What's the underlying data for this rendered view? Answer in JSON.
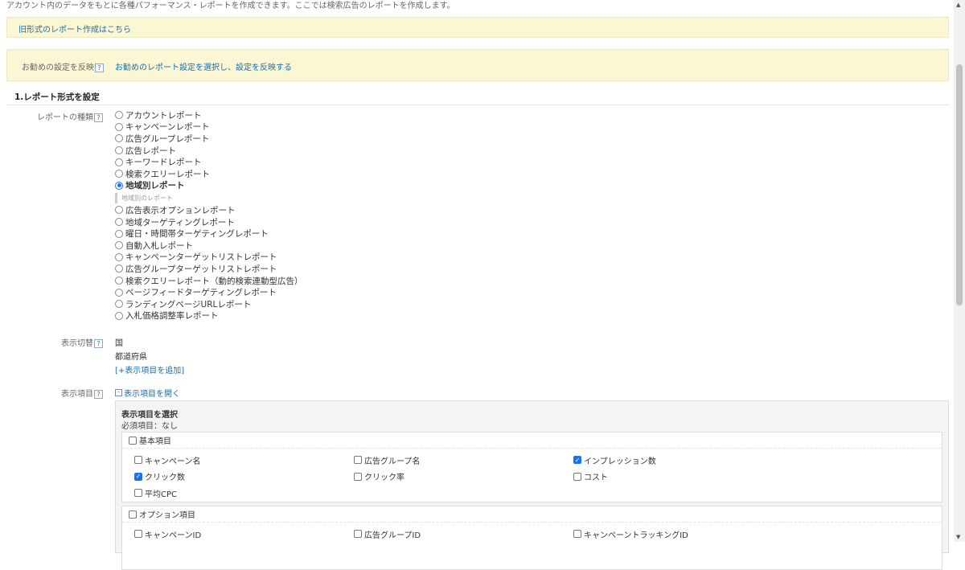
{
  "intro": "アカウント内のデータをもとに各種パフォーマンス・レポートを作成できます。ここでは検索広告のレポートを作成します。",
  "legacy_link": "旧形式のレポート作成はこちら",
  "recommend": {
    "label": "お勧めの設定を反映",
    "link": "お勧めのレポート設定を選択し、設定を反映する"
  },
  "help": "?",
  "section1": "1.レポート形式を設定",
  "report_type": {
    "label": "レポートの種類",
    "options_top": [
      "アカウントレポート",
      "キャンペーンレポート",
      "広告グループレポート",
      "広告レポート",
      "キーワードレポート",
      "検索クエリーレポート"
    ],
    "selected": "地域別レポート",
    "sub_note": "地域別のレポート",
    "options_bottom": [
      "広告表示オプションレポート",
      "地域ターゲティングレポート",
      "曜日・時間帯ターゲティングレポート",
      "自動入札レポート",
      "キャンペーンターゲットリストレポート",
      "広告グループターゲットリストレポート",
      "検索クエリーレポート（動的検索連動型広告）",
      "ページフィードターゲティングレポート",
      "ランディングページURLレポート",
      "入札価格調整率レポート"
    ]
  },
  "display_switch": {
    "label": "表示切替",
    "items": [
      "国",
      "都道府県"
    ],
    "add_link": "[+表示項目を追加]"
  },
  "display_items": {
    "label": "表示項目",
    "toggle": "表示項目を開く",
    "panel_title": "表示項目を選択",
    "required": "必須項目：なし",
    "groups": [
      {
        "name": "基本項目",
        "items": [
          {
            "label": "キャンペーン名",
            "checked": false
          },
          {
            "label": "広告グループ名",
            "checked": false
          },
          {
            "label": "インプレッション数",
            "checked": true
          },
          {
            "label": "クリック数",
            "checked": true
          },
          {
            "label": "クリック率",
            "checked": false
          },
          {
            "label": "コスト",
            "checked": false
          },
          {
            "label": "平均CPC",
            "checked": false
          }
        ]
      },
      {
        "name": "オプション項目",
        "items": [
          {
            "label": "キャンペーンID",
            "checked": false
          },
          {
            "label": "広告グループID",
            "checked": false
          },
          {
            "label": "キャンペーントラッキングID",
            "checked": false
          }
        ]
      }
    ]
  }
}
